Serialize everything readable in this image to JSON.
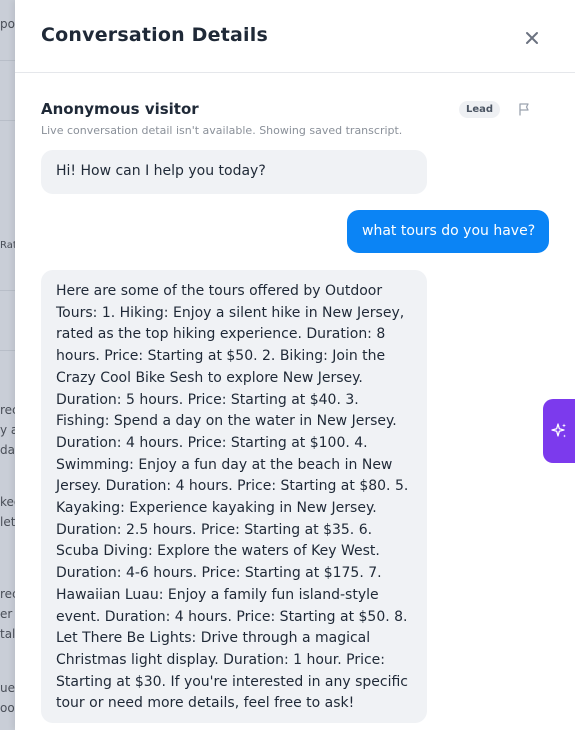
{
  "background": {
    "fragments": [
      "po",
      "Rat",
      "rec",
      "y a",
      "day",
      "ked",
      "let",
      "rec",
      "er",
      "tal",
      "ue",
      "oo"
    ]
  },
  "panel": {
    "title": "Conversation Details",
    "close_icon": "close-icon"
  },
  "visitor": {
    "name": "Anonymous visitor",
    "status_note": "Live conversation detail isn't available. Showing saved transcript.",
    "badge": "Lead",
    "flag_icon": "flag-icon"
  },
  "messages": [
    {
      "sender": "bot",
      "text": "Hi! How can I help you today?"
    },
    {
      "sender": "user",
      "text": "what tours do you have?"
    },
    {
      "sender": "bot",
      "text": "Here are some of the tours offered by Outdoor Tours: 1. Hiking: Enjoy a silent hike in New Jersey, rated as the top hiking experience. Duration: 8 hours. Price: Starting at $50. 2. Biking: Join the Crazy Cool Bike Sesh to explore New Jersey. Duration: 5 hours. Price: Starting at $40. 3. Fishing: Spend a day on the water in New Jersey. Duration: 4 hours. Price: Starting at $100. 4. Swimming: Enjoy a fun day at the beach in New Jersey. Duration: 4 hours. Price: Starting at $80. 5. Kayaking: Experience kayaking in New Jersey. Duration: 2.5 hours. Price: Starting at $35. 6. Scuba Diving: Explore the waters of Key West. Duration: 4-6 hours. Price: Starting at $175. 7. Hawaiian Luau: Enjoy a family fun island-style event. Duration: 4 hours. Price: Starting at $50. 8. Let There Be Lights: Drive through a magical Christmas light display. Duration: 1 hour. Price: Starting at $30. If you're interested in any specific tour or need more details, feel free to ask!"
    }
  ],
  "ai_assistant": {
    "icon": "sparkles-icon",
    "color": "#7c3aed"
  },
  "colors": {
    "user_bubble": "#0b84f5",
    "bot_bubble": "#f0f2f5",
    "lead_badge_bg": "#eef0f3"
  }
}
